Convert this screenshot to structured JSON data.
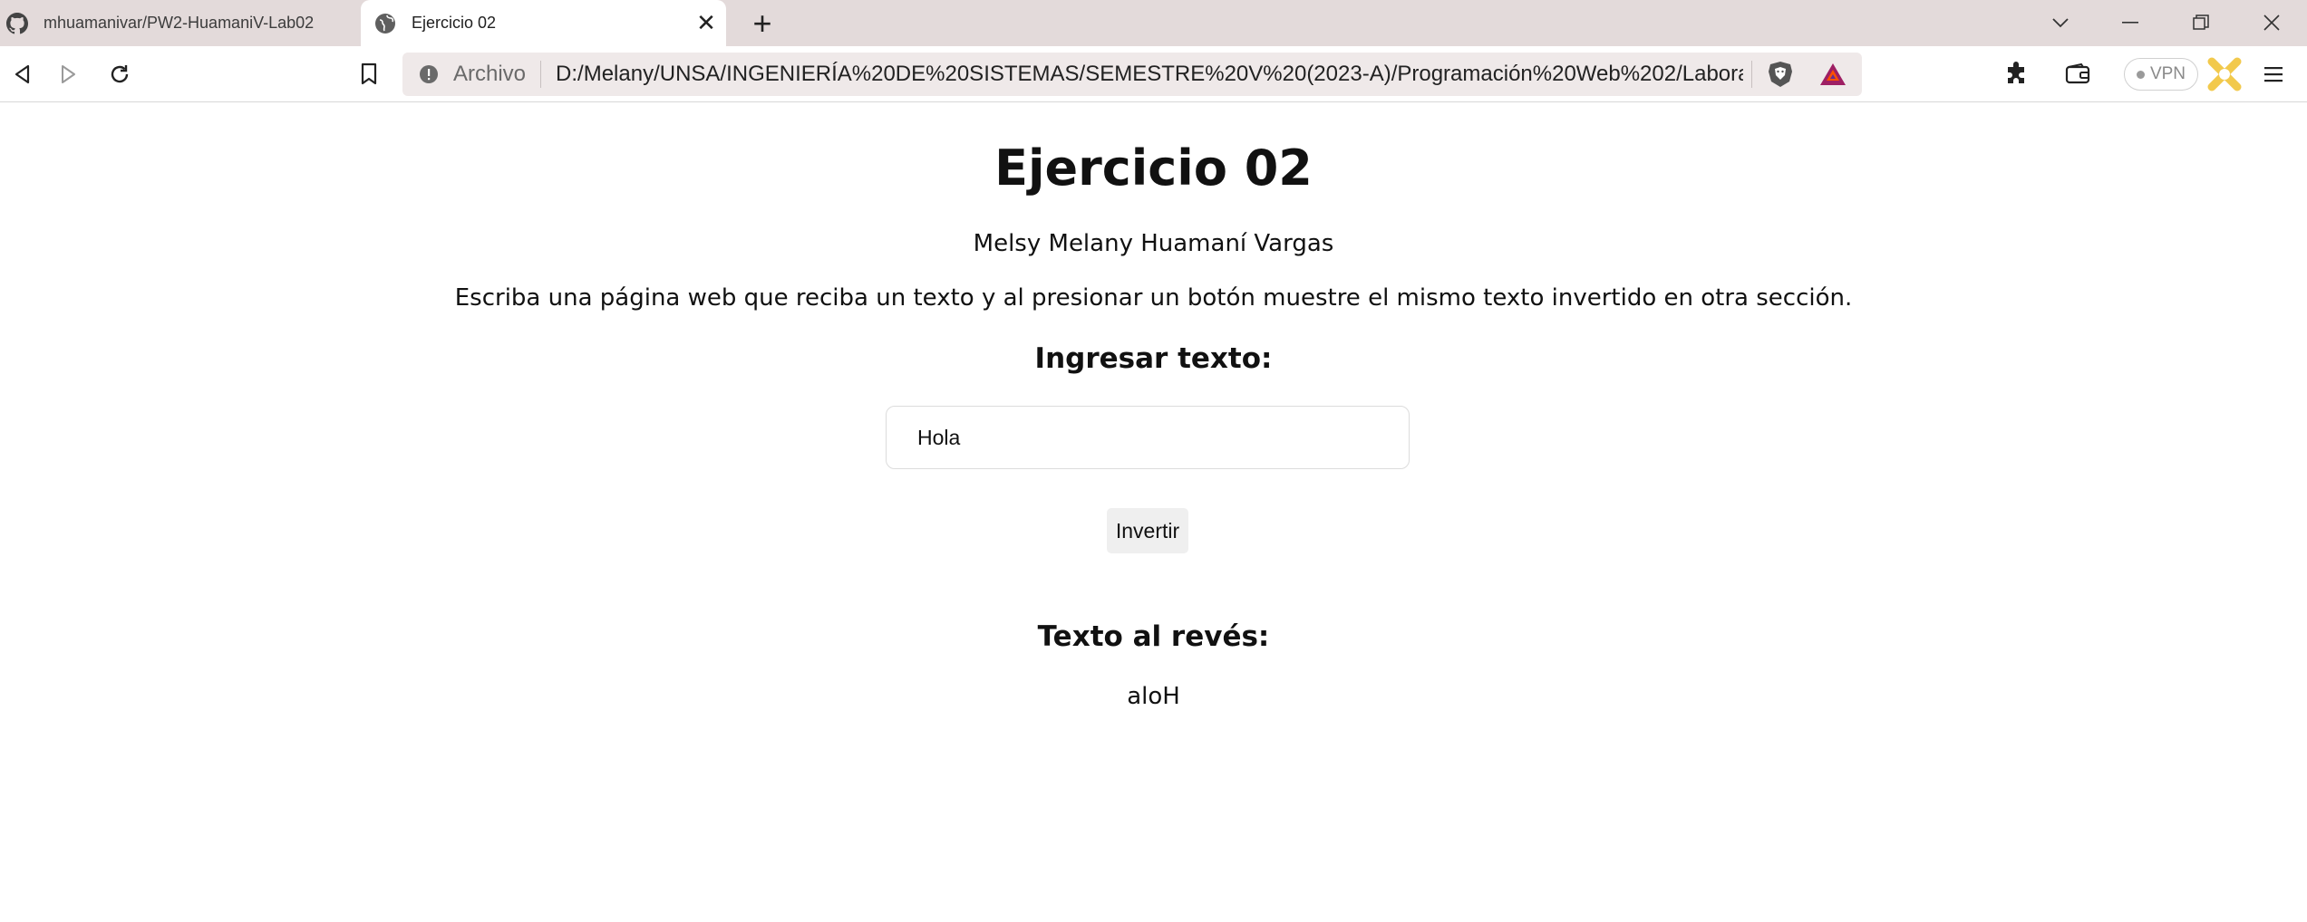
{
  "browser": {
    "tabs": [
      {
        "title": "mhuamanivar/PW2-HuamaniV-Lab02",
        "favicon": "github-icon",
        "active": false
      },
      {
        "title": "Ejercicio 02",
        "favicon": "globe-icon",
        "active": true
      }
    ],
    "address_bar": {
      "scheme_label": "Archivo",
      "url": "D:/Melany/UNSA/INGENIERÍA%20DE%20SISTEMAS/SEMESTRE%20V%20(2023-A)/Programación%20Web%202/Laboratorio..."
    },
    "vpn_label": "VPN"
  },
  "page": {
    "title": "Ejercicio 02",
    "author": "Melsy Melany Huamaní Vargas",
    "description": "Escriba una página web que reciba un texto y al presionar un botón muestre el mismo texto invertido en otra sección.",
    "input_heading": "Ingresar texto:",
    "input_value": "Hola",
    "button_label": "Invertir",
    "result_heading": "Texto al revés:",
    "result_text": "aloH"
  },
  "colors": {
    "tabstrip_bg": "#e3dada",
    "omnibox_bg": "#efe9e9",
    "brave_lion": "#fb542b",
    "bat_triangle": "#9e1f63",
    "wallet_gold": "#f2c94c"
  }
}
